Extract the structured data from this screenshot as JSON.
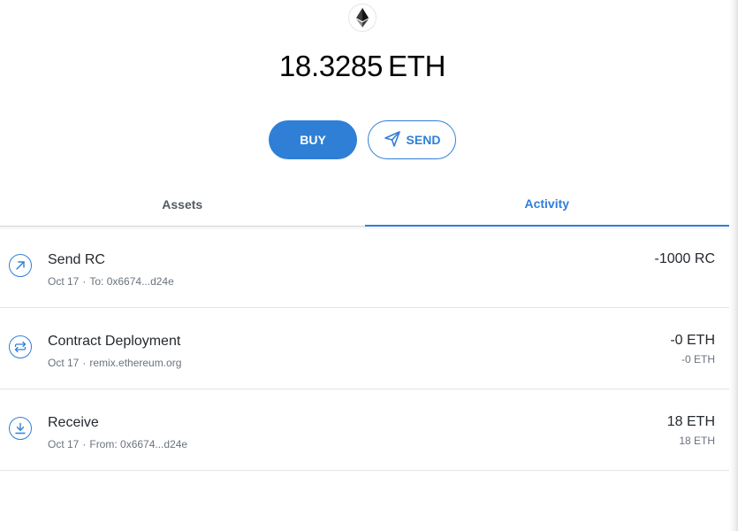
{
  "balance": {
    "amount": "18.3285",
    "unit": "ETH"
  },
  "token_icon": "ethereum-icon",
  "actions": {
    "buy_label": "BUY",
    "send_label": "SEND",
    "send_icon": "paper-plane-icon"
  },
  "tabs": [
    {
      "label": "Assets",
      "active": false
    },
    {
      "label": "Activity",
      "active": true
    }
  ],
  "colors": {
    "accent": "#2f7fd6",
    "text_primary": "#24292e",
    "text_secondary": "#6a737d",
    "divider": "#e3e5e8"
  },
  "transactions": [
    {
      "title": "Send RC",
      "date": "Oct 17",
      "detail": "To: 0x6674...d24e",
      "amount": "-1000 RC",
      "fiat": "",
      "icon": "arrow-up-right-icon"
    },
    {
      "title": "Contract Deployment",
      "date": "Oct 17",
      "detail": "remix.ethereum.org",
      "amount": "-0 ETH",
      "fiat": "-0 ETH",
      "icon": "swap-arrows-icon"
    },
    {
      "title": "Receive",
      "date": "Oct 17",
      "detail": "From: 0x6674...d24e",
      "amount": "18 ETH",
      "fiat": "18 ETH",
      "icon": "download-icon"
    }
  ]
}
